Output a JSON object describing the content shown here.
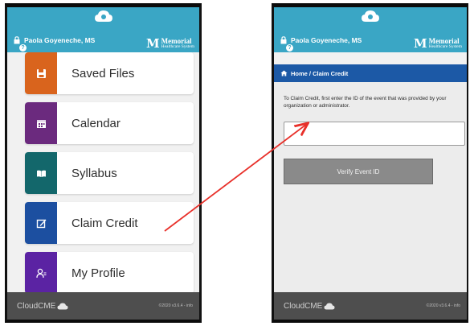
{
  "left_screen": {
    "user_name": "Paola Goyeneche, MS",
    "brand_mark": "M",
    "brand_name": "Memorial",
    "brand_sub": "Healthcare System",
    "help_glyph": "?",
    "menu": [
      {
        "label": "Saved Files",
        "icon": "save-icon",
        "color": "#d9641d"
      },
      {
        "label": "Calendar",
        "icon": "calendar-icon",
        "color": "#6b2a7e"
      },
      {
        "label": "Syllabus",
        "icon": "book-icon",
        "color": "#13676b"
      },
      {
        "label": "Claim Credit",
        "icon": "edit-icon",
        "color": "#1c4fa0"
      },
      {
        "label": "My Profile",
        "icon": "profile-icon",
        "color": "#5b23a3"
      }
    ],
    "footer_logo": "CloudCME",
    "footer_version": "©2020 v3.6.4 - info"
  },
  "right_screen": {
    "user_name": "Paola Goyeneche, MS",
    "brand_mark": "M",
    "brand_name": "Memorial",
    "brand_sub": "Healthcare System",
    "help_glyph": "?",
    "breadcrumb": "Home / Claim Credit",
    "instructions": "To Claim Credit, first enter the ID of the event that was provided by your organization or administrator.",
    "event_id_value": "",
    "verify_button": "Verify Event ID",
    "footer_logo": "CloudCME",
    "footer_version": "©2020 v3.6.4 - info"
  },
  "colors": {
    "header": "#3aa6c5",
    "breadcrumb": "#1c59a6",
    "arrow": "#e8302a",
    "footer": "#4e4e4e"
  }
}
